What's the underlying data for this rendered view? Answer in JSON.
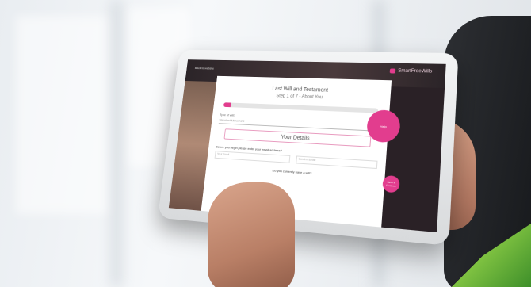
{
  "screen": {
    "top_link": "Back to website",
    "brand": "SmartFreeWills",
    "title": "Last Will and Testament",
    "step": "Step 1 of 7 - About You",
    "progress_percent": 5,
    "type_label": "Type of will?",
    "type_value": "Standard Mirror Will",
    "section_button": "Your Details",
    "email_question": "Before you begin please enter your email address?",
    "email_placeholder": "Your Email",
    "confirm_placeholder": "Confirm Email",
    "will_question": "Do you currently have a will?",
    "big_circle_label": "Help",
    "small_circle_label": "Save & Continue"
  },
  "colors": {
    "accent": "#e23d8e",
    "corner": "#7fc241"
  }
}
